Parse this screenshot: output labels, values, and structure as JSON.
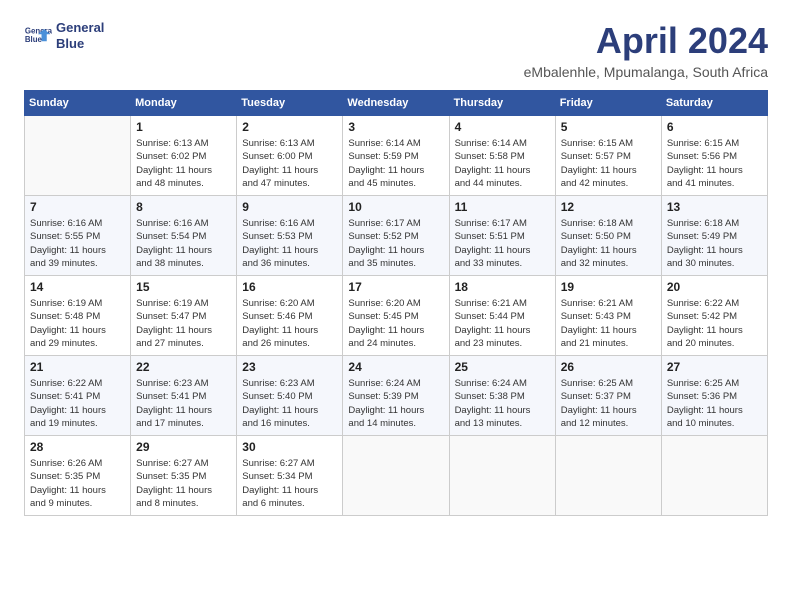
{
  "header": {
    "logo_line1": "General",
    "logo_line2": "Blue",
    "month": "April 2024",
    "location": "eMbalenhle, Mpumalanga, South Africa"
  },
  "weekdays": [
    "Sunday",
    "Monday",
    "Tuesday",
    "Wednesday",
    "Thursday",
    "Friday",
    "Saturday"
  ],
  "weeks": [
    [
      {
        "day": "",
        "detail": ""
      },
      {
        "day": "1",
        "detail": "Sunrise: 6:13 AM\nSunset: 6:02 PM\nDaylight: 11 hours\nand 48 minutes."
      },
      {
        "day": "2",
        "detail": "Sunrise: 6:13 AM\nSunset: 6:00 PM\nDaylight: 11 hours\nand 47 minutes."
      },
      {
        "day": "3",
        "detail": "Sunrise: 6:14 AM\nSunset: 5:59 PM\nDaylight: 11 hours\nand 45 minutes."
      },
      {
        "day": "4",
        "detail": "Sunrise: 6:14 AM\nSunset: 5:58 PM\nDaylight: 11 hours\nand 44 minutes."
      },
      {
        "day": "5",
        "detail": "Sunrise: 6:15 AM\nSunset: 5:57 PM\nDaylight: 11 hours\nand 42 minutes."
      },
      {
        "day": "6",
        "detail": "Sunrise: 6:15 AM\nSunset: 5:56 PM\nDaylight: 11 hours\nand 41 minutes."
      }
    ],
    [
      {
        "day": "7",
        "detail": "Sunrise: 6:16 AM\nSunset: 5:55 PM\nDaylight: 11 hours\nand 39 minutes."
      },
      {
        "day": "8",
        "detail": "Sunrise: 6:16 AM\nSunset: 5:54 PM\nDaylight: 11 hours\nand 38 minutes."
      },
      {
        "day": "9",
        "detail": "Sunrise: 6:16 AM\nSunset: 5:53 PM\nDaylight: 11 hours\nand 36 minutes."
      },
      {
        "day": "10",
        "detail": "Sunrise: 6:17 AM\nSunset: 5:52 PM\nDaylight: 11 hours\nand 35 minutes."
      },
      {
        "day": "11",
        "detail": "Sunrise: 6:17 AM\nSunset: 5:51 PM\nDaylight: 11 hours\nand 33 minutes."
      },
      {
        "day": "12",
        "detail": "Sunrise: 6:18 AM\nSunset: 5:50 PM\nDaylight: 11 hours\nand 32 minutes."
      },
      {
        "day": "13",
        "detail": "Sunrise: 6:18 AM\nSunset: 5:49 PM\nDaylight: 11 hours\nand 30 minutes."
      }
    ],
    [
      {
        "day": "14",
        "detail": "Sunrise: 6:19 AM\nSunset: 5:48 PM\nDaylight: 11 hours\nand 29 minutes."
      },
      {
        "day": "15",
        "detail": "Sunrise: 6:19 AM\nSunset: 5:47 PM\nDaylight: 11 hours\nand 27 minutes."
      },
      {
        "day": "16",
        "detail": "Sunrise: 6:20 AM\nSunset: 5:46 PM\nDaylight: 11 hours\nand 26 minutes."
      },
      {
        "day": "17",
        "detail": "Sunrise: 6:20 AM\nSunset: 5:45 PM\nDaylight: 11 hours\nand 24 minutes."
      },
      {
        "day": "18",
        "detail": "Sunrise: 6:21 AM\nSunset: 5:44 PM\nDaylight: 11 hours\nand 23 minutes."
      },
      {
        "day": "19",
        "detail": "Sunrise: 6:21 AM\nSunset: 5:43 PM\nDaylight: 11 hours\nand 21 minutes."
      },
      {
        "day": "20",
        "detail": "Sunrise: 6:22 AM\nSunset: 5:42 PM\nDaylight: 11 hours\nand 20 minutes."
      }
    ],
    [
      {
        "day": "21",
        "detail": "Sunrise: 6:22 AM\nSunset: 5:41 PM\nDaylight: 11 hours\nand 19 minutes."
      },
      {
        "day": "22",
        "detail": "Sunrise: 6:23 AM\nSunset: 5:41 PM\nDaylight: 11 hours\nand 17 minutes."
      },
      {
        "day": "23",
        "detail": "Sunrise: 6:23 AM\nSunset: 5:40 PM\nDaylight: 11 hours\nand 16 minutes."
      },
      {
        "day": "24",
        "detail": "Sunrise: 6:24 AM\nSunset: 5:39 PM\nDaylight: 11 hours\nand 14 minutes."
      },
      {
        "day": "25",
        "detail": "Sunrise: 6:24 AM\nSunset: 5:38 PM\nDaylight: 11 hours\nand 13 minutes."
      },
      {
        "day": "26",
        "detail": "Sunrise: 6:25 AM\nSunset: 5:37 PM\nDaylight: 11 hours\nand 12 minutes."
      },
      {
        "day": "27",
        "detail": "Sunrise: 6:25 AM\nSunset: 5:36 PM\nDaylight: 11 hours\nand 10 minutes."
      }
    ],
    [
      {
        "day": "28",
        "detail": "Sunrise: 6:26 AM\nSunset: 5:35 PM\nDaylight: 11 hours\nand 9 minutes."
      },
      {
        "day": "29",
        "detail": "Sunrise: 6:27 AM\nSunset: 5:35 PM\nDaylight: 11 hours\nand 8 minutes."
      },
      {
        "day": "30",
        "detail": "Sunrise: 6:27 AM\nSunset: 5:34 PM\nDaylight: 11 hours\nand 6 minutes."
      },
      {
        "day": "",
        "detail": ""
      },
      {
        "day": "",
        "detail": ""
      },
      {
        "day": "",
        "detail": ""
      },
      {
        "day": "",
        "detail": ""
      }
    ]
  ]
}
